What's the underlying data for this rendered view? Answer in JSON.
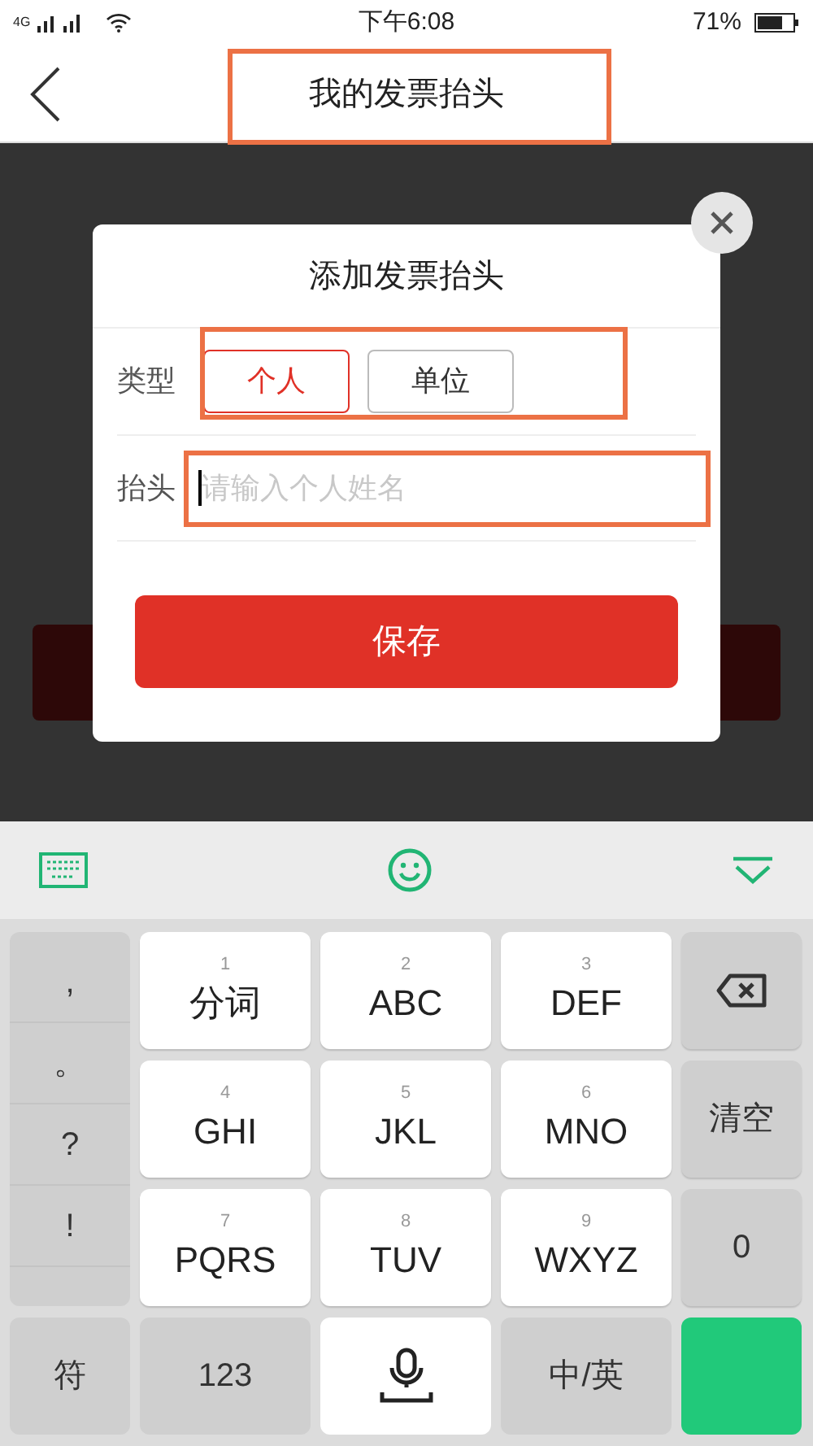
{
  "status_bar": {
    "network": "4G",
    "time": "下午6:08",
    "battery": "71%"
  },
  "header": {
    "title": "我的发票抬头"
  },
  "dialog": {
    "title": "添加发票抬头",
    "type_label": "类型",
    "type_options": [
      {
        "label": "个人",
        "selected": true
      },
      {
        "label": "单位",
        "selected": false
      }
    ],
    "name_label": "抬头",
    "name_field": {
      "placeholder": "请输入个人姓名",
      "focused": true
    },
    "save_button": "保存"
  },
  "keyboard": {
    "punctuation": [
      ",",
      "。",
      "?",
      "!"
    ],
    "keys": [
      {
        "kind": "letter",
        "number": "1",
        "label": "分词"
      },
      {
        "kind": "letter",
        "number": "2",
        "label": "ABC"
      },
      {
        "kind": "letter",
        "number": "3",
        "label": "DEF"
      },
      {
        "kind": "backspace"
      },
      {
        "kind": "letter",
        "number": "4",
        "label": "GHI"
      },
      {
        "kind": "letter",
        "number": "5",
        "label": "JKL"
      },
      {
        "kind": "letter",
        "number": "6",
        "label": "MNO"
      },
      {
        "kind": "function",
        "label": "清空"
      },
      {
        "kind": "letter",
        "number": "7",
        "label": "PQRS"
      },
      {
        "kind": "letter",
        "number": "8",
        "label": "TUV"
      },
      {
        "kind": "letter",
        "number": "9",
        "label": "WXYZ"
      },
      {
        "kind": "function",
        "label": "0"
      }
    ],
    "bottom_keys": [
      {
        "kind": "function",
        "label": "符"
      },
      {
        "kind": "function",
        "label": "123"
      },
      {
        "kind": "space"
      },
      {
        "kind": "function",
        "label": "中/英"
      },
      {
        "kind": "enter"
      }
    ]
  }
}
